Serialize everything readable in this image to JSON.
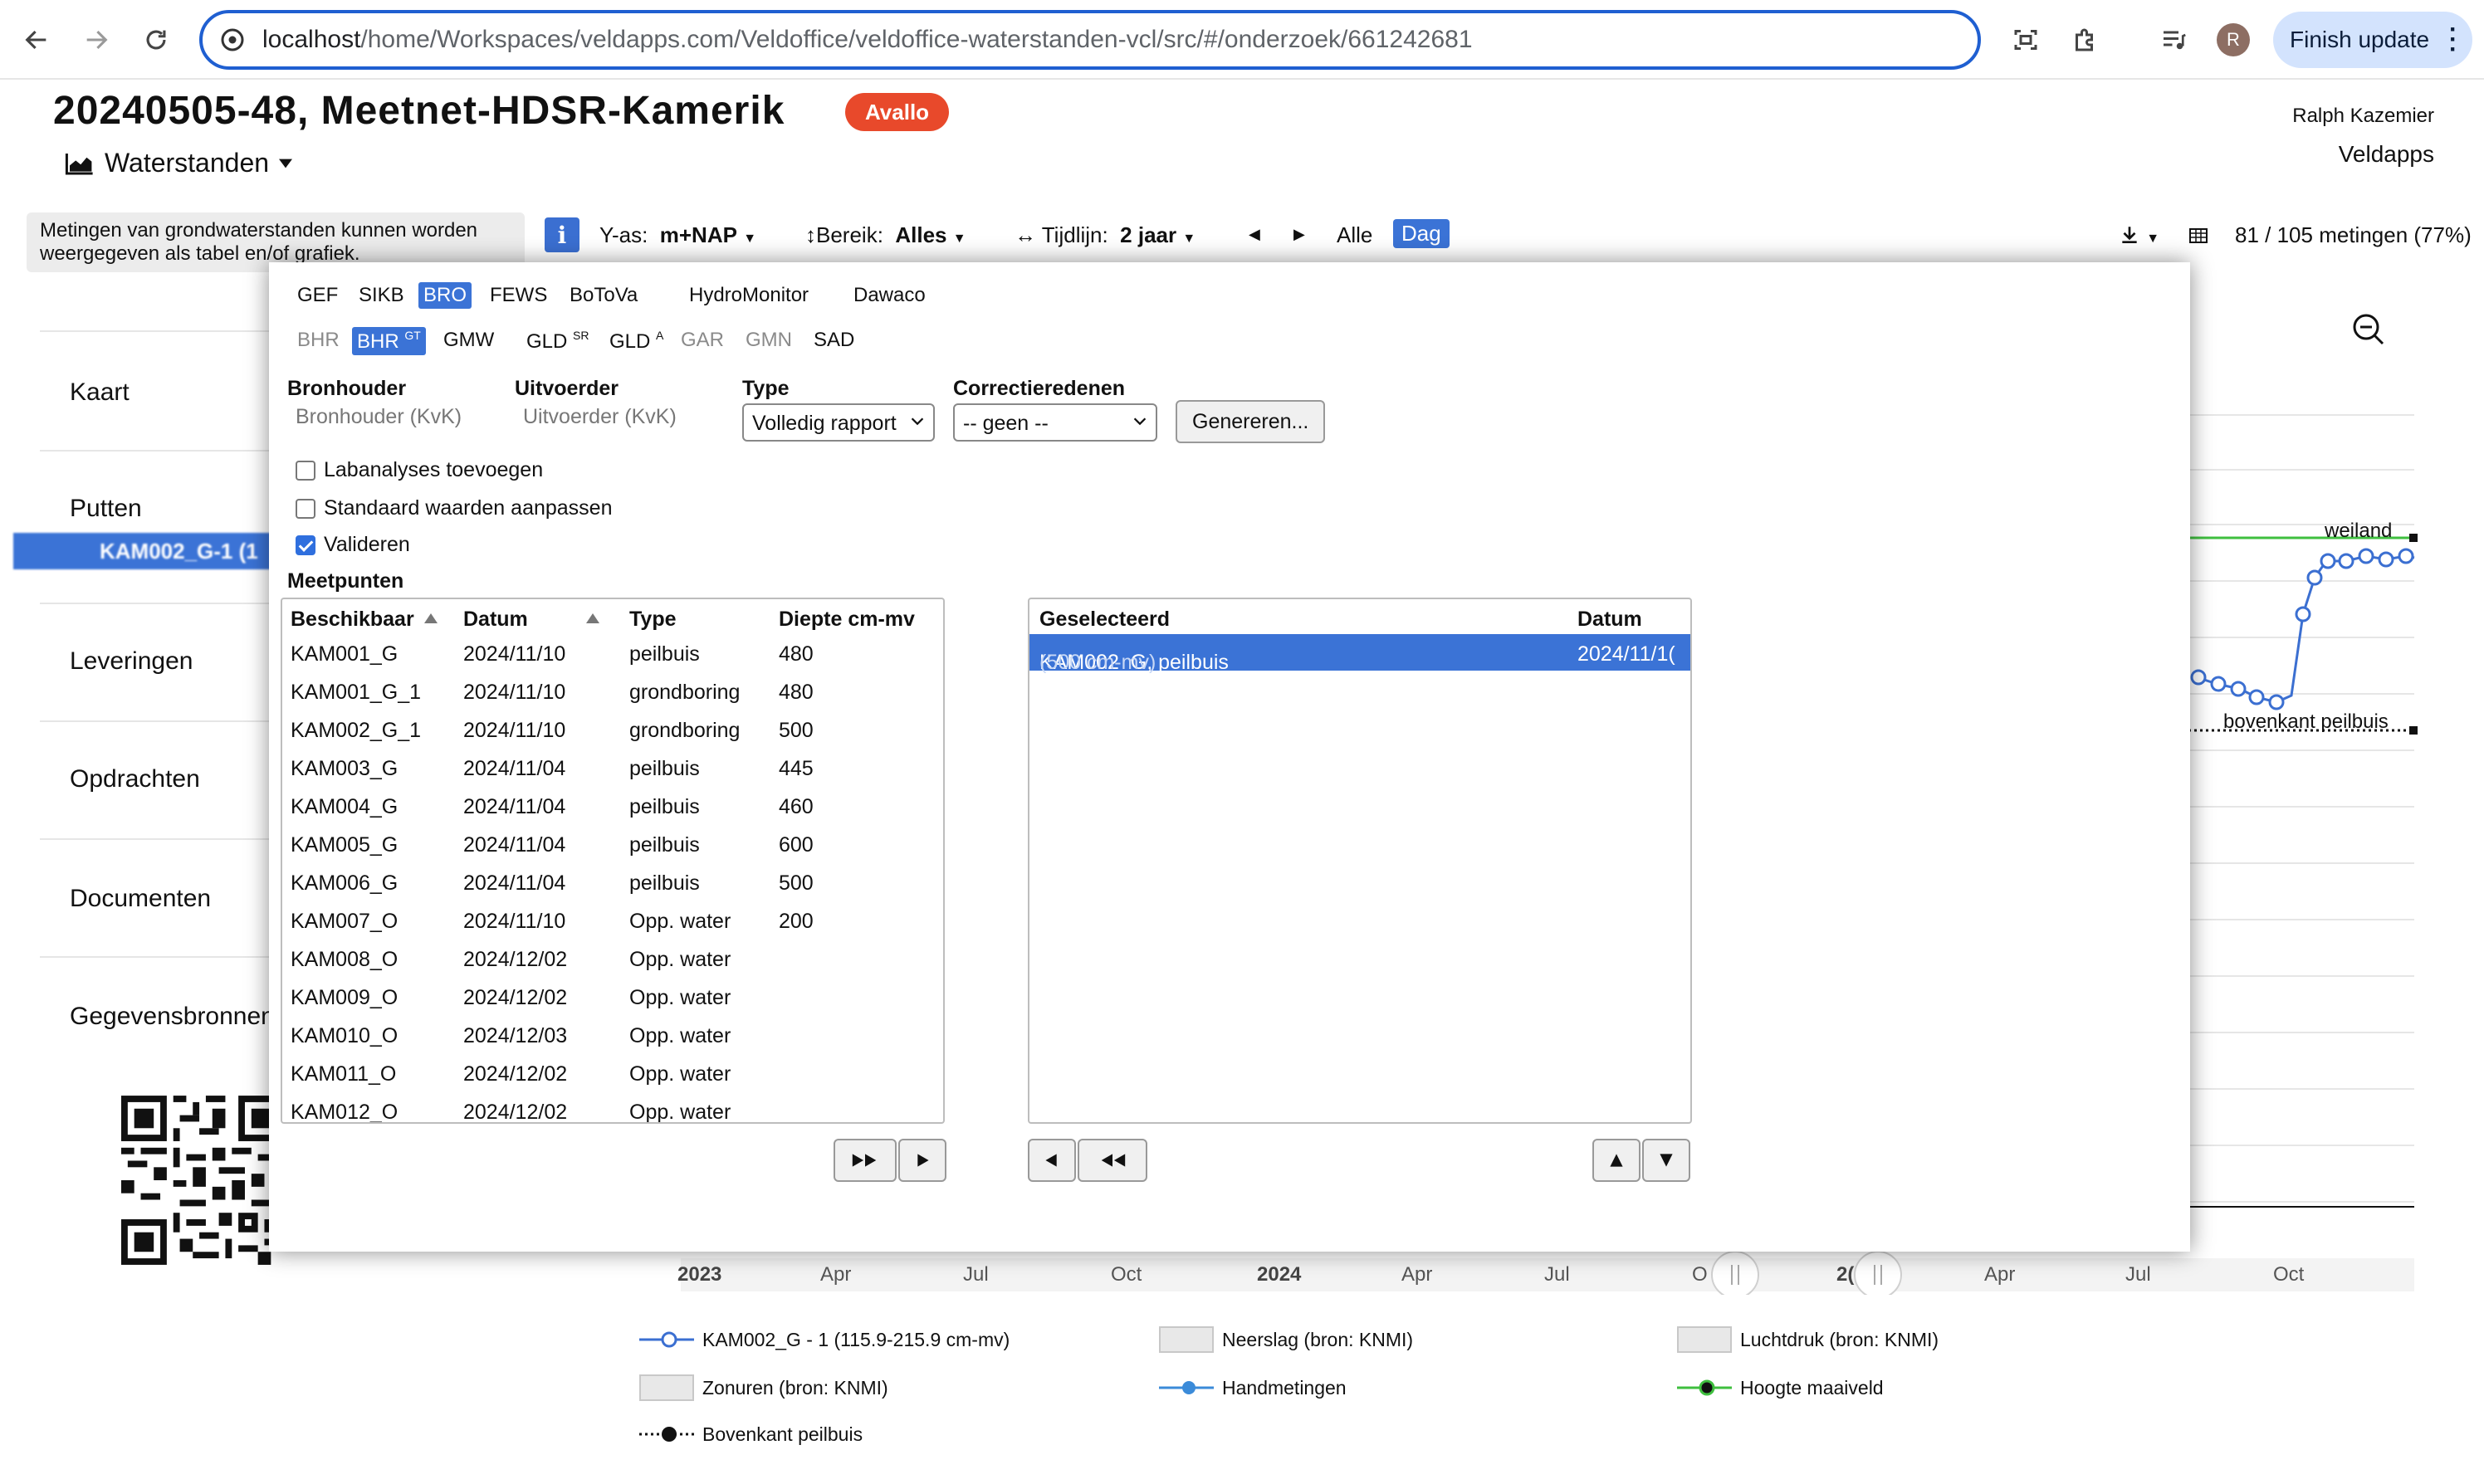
{
  "browser": {
    "url_host": "localhost",
    "url_path": "/home/Workspaces/veldapps.com/Veldoffice/veldoffice-waterstanden-vcl/src/#/onderzoek/661242681",
    "avatar_letter": "R",
    "finish_update_label": "Finish update"
  },
  "header": {
    "title": "20240505-48, Meetnet-HDSR-Kamerik",
    "badge": "Avallo",
    "view_label": "Waterstanden",
    "user_name": "Ralph Kazemier",
    "org_name": "Veldapps"
  },
  "sidebar": {
    "help_text": "Metingen van grondwaterstanden kunnen worden weergegeven als tabel en/of grafiek.",
    "items": [
      "Kaart",
      "Putten",
      "Leveringen",
      "Opdrachten",
      "Documenten",
      "Gegevensbronnen"
    ],
    "selected_put": "KAM002_G-1 (1"
  },
  "toolbar": {
    "y_axis_label": "Y-as:",
    "y_axis_value": "m+NAP",
    "range_label": "Bereik:",
    "range_value": "Alles",
    "timeline_label": "Tijdlijn:",
    "timeline_value": "2 jaar",
    "all_label": "Alle",
    "day_label": "Dag",
    "count": "81 / 105 metingen (77%)"
  },
  "chart": {
    "x_ticks": [
      "2023",
      "Apr",
      "Jul",
      "Oct",
      "2024",
      "Apr",
      "Jul",
      "O",
      "2(",
      "Apr",
      "Jul",
      "Oct"
    ],
    "annot_weiland": "weiland",
    "annot_bovenkant": "bovenkant peilbuis",
    "series_color": "#3b6fd1",
    "maaiveld_color": "#3fbf3f"
  },
  "legend": [
    {
      "label": "KAM002_G - 1 (115.9-215.9 cm-mv)",
      "icon": "line-open-circle"
    },
    {
      "label": "Neerslag (bron: KNMI)",
      "icon": "grey-box"
    },
    {
      "label": "Luchtdruk (bron: KNMI)",
      "icon": "grey-box"
    },
    {
      "label": "Zonuren (bron: KNMI)",
      "icon": "grey-box"
    },
    {
      "label": "Handmetingen",
      "icon": "line-filled-circle"
    },
    {
      "label": "Hoogte maaiveld",
      "icon": "green-line-black-dot"
    },
    {
      "label": "Bovenkant peilbuis",
      "icon": "dotted-line-black-dot"
    }
  ],
  "modal": {
    "tabs_row1": [
      "GEF",
      "SIKB",
      "BRO",
      "FEWS",
      "BoToVa",
      "HydroMonitor",
      "Dawaco"
    ],
    "tabs_row1_active": "BRO",
    "tabs_row2": [
      "BHR",
      "BHR",
      "GMW",
      "GLD",
      "GLD",
      "GAR",
      "GMN",
      "SAD"
    ],
    "tabs_row2_sup": {
      "bhr_gt": "GT",
      "gld_sr": "SR",
      "gld_a": "A"
    },
    "fields": {
      "bronhouder_label": "Bronhouder",
      "bronhouder_placeholder": "Bronhouder (KvK)",
      "uitvoerder_label": "Uitvoerder",
      "uitvoerder_placeholder": "Uitvoerder (KvK)",
      "type_label": "Type",
      "type_value": "Volledig rapport",
      "correctie_label": "Correctieredenen",
      "correctie_value": "-- geen --",
      "generate_label": "Genereren..."
    },
    "checks": [
      {
        "label": "Labanalyses toevoegen",
        "checked": false
      },
      {
        "label": "Standaard waarden aanpassen",
        "checked": false
      },
      {
        "label": "Valideren",
        "checked": true
      }
    ],
    "meetpunten_title": "Meetpunten",
    "available": {
      "headers": [
        "Beschikbaar",
        "Datum",
        "Type",
        "Diepte cm-mv"
      ],
      "rows": [
        [
          "KAM001_G",
          "2024/11/10",
          "peilbuis",
          "480"
        ],
        [
          "KAM001_G_1",
          "2024/11/10",
          "grondboring",
          "480"
        ],
        [
          "KAM002_G_1",
          "2024/11/10",
          "grondboring",
          "500"
        ],
        [
          "KAM003_G",
          "2024/11/04",
          "peilbuis",
          "445"
        ],
        [
          "KAM004_G",
          "2024/11/04",
          "peilbuis",
          "460"
        ],
        [
          "KAM005_G",
          "2024/11/04",
          "peilbuis",
          "600"
        ],
        [
          "KAM006_G",
          "2024/11/04",
          "peilbuis",
          "500"
        ],
        [
          "KAM007_O",
          "2024/11/10",
          "Opp. water",
          "200"
        ],
        [
          "KAM008_O",
          "2024/12/02",
          "Opp. water",
          ""
        ],
        [
          "KAM009_O",
          "2024/12/02",
          "Opp. water",
          ""
        ],
        [
          "KAM010_O",
          "2024/12/03",
          "Opp. water",
          ""
        ],
        [
          "KAM011_O",
          "2024/12/02",
          "Opp. water",
          ""
        ],
        [
          "KAM012_O",
          "2024/12/02",
          "Opp. water",
          ""
        ]
      ]
    },
    "selected": {
      "headers": [
        "Geselecteerd",
        "Datum"
      ],
      "rows": [
        {
          "name": "KAM002_G, peilbuis",
          "depth": "(500 cm-mv)",
          "date": "2024/11/1("
        }
      ]
    }
  }
}
